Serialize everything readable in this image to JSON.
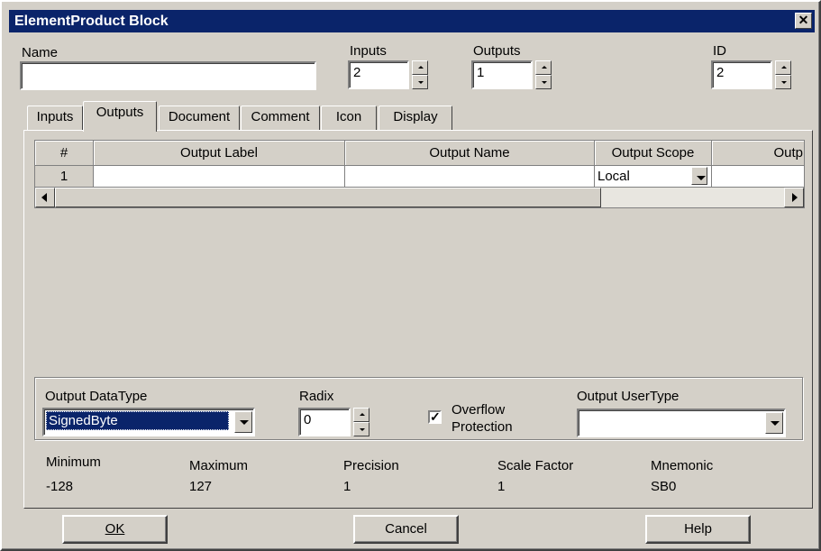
{
  "window": {
    "title": "ElementProduct Block",
    "close_glyph": "✕"
  },
  "fields": {
    "name": {
      "label": "Name",
      "value": ""
    },
    "inputs": {
      "label": "Inputs",
      "value": "2"
    },
    "outputs": {
      "label": "Outputs",
      "value": "1"
    },
    "id": {
      "label": "ID",
      "value": "2"
    }
  },
  "tabs": [
    {
      "label": "Inputs",
      "active": false
    },
    {
      "label": "Outputs",
      "active": true
    },
    {
      "label": "Document",
      "active": false
    },
    {
      "label": "Comment",
      "active": false
    },
    {
      "label": "Icon",
      "active": false
    },
    {
      "label": "Display",
      "active": false
    }
  ],
  "grid": {
    "columns": [
      "#",
      "Output Label",
      "Output Name",
      "Output Scope",
      "Outp"
    ],
    "rows": [
      {
        "num": "1",
        "label": "",
        "name": "",
        "scope": "Local",
        "extra": ""
      }
    ]
  },
  "group": {
    "datatype_label": "Output DataType",
    "datatype_value": "SignedByte",
    "radix_label": "Radix",
    "radix_value": "0",
    "overflow_label_1": "Overflow",
    "overflow_label_2": "Protection",
    "overflow_checked": "✓",
    "usertype_label": "Output UserType",
    "usertype_value": ""
  },
  "stats": [
    {
      "label": "Minimum",
      "value": "-128"
    },
    {
      "label": "Maximum",
      "value": "127"
    },
    {
      "label": "Precision",
      "value": "1"
    },
    {
      "label": "Scale Factor",
      "value": "1"
    },
    {
      "label": "Mnemonic",
      "value": "SB0"
    }
  ],
  "buttons": {
    "ok": "OK",
    "cancel": "Cancel",
    "help": "Help"
  },
  "colors": {
    "titlebar": "#0a246a",
    "face": "#d4d0c8",
    "selection": "#0a246a"
  }
}
